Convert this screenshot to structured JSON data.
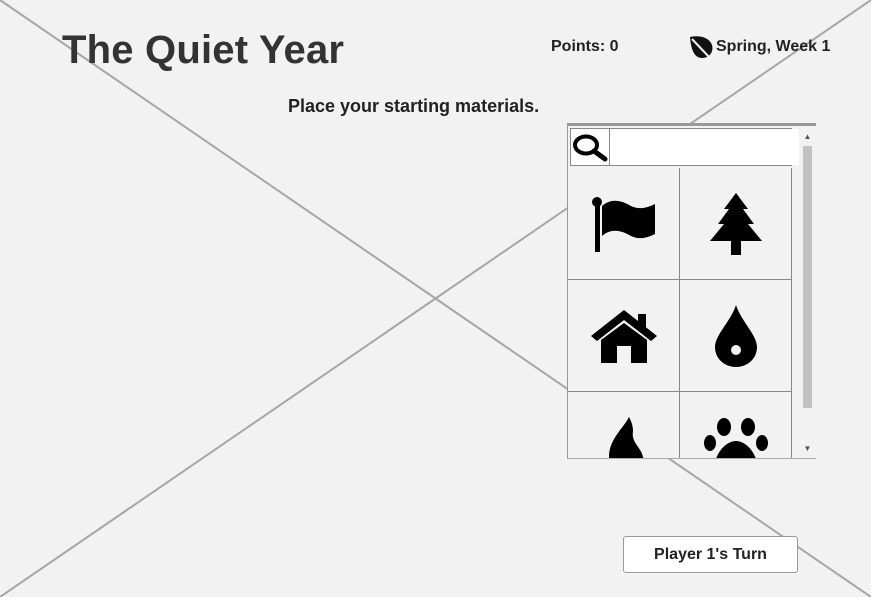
{
  "header": {
    "title": "The Quiet Year",
    "points_text": "Points: 0",
    "season_icon": "leaf-icon",
    "season_text": "Spring, Week 1"
  },
  "prompt": "Place your starting materials.",
  "picker": {
    "search_icon": "search-icon",
    "search": {
      "value": "",
      "placeholder": ""
    },
    "items": [
      {
        "icon": "flag-icon"
      },
      {
        "icon": "tree-icon"
      },
      {
        "icon": "house-icon"
      },
      {
        "icon": "water-drop-icon"
      },
      {
        "icon": "fire-icon"
      },
      {
        "icon": "paw-icon"
      }
    ]
  },
  "footer": {
    "turn_button_label": "Player 1's Turn"
  },
  "colors": {
    "background": "#f2f2f2",
    "text": "#333333",
    "icon": "#000000",
    "cross_lines": "#a6a6a6"
  }
}
